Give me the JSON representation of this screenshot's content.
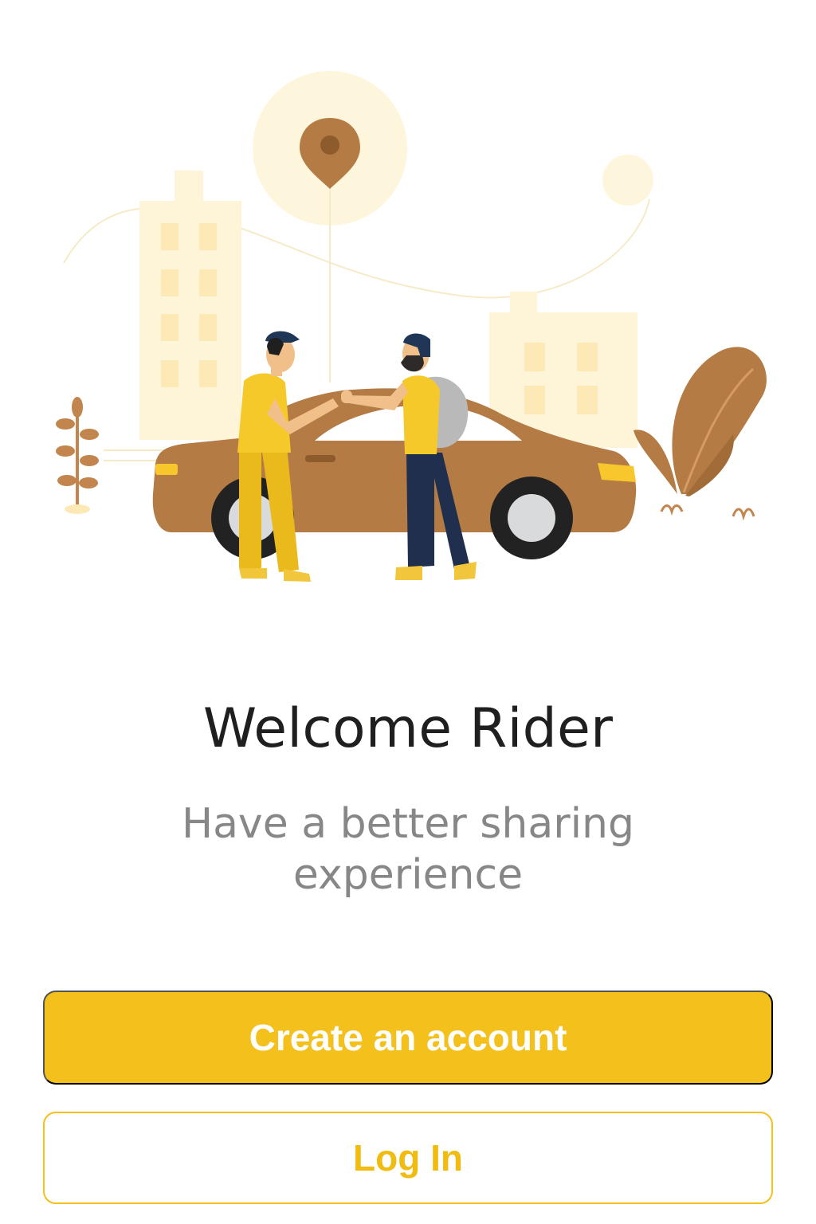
{
  "hero": {
    "illustration": "rider-greeting-driver-illustration",
    "icons": [
      "location-pin-icon",
      "car-icon"
    ]
  },
  "welcome": {
    "title": "Welcome Rider",
    "subtitle": "Have a better sharing experience"
  },
  "actions": {
    "create_account_label": "Create an account",
    "login_label": "Log In"
  },
  "colors": {
    "accent": "#f3c01c",
    "car": "#b47b45",
    "background": "#ffffff",
    "title_text": "#1f1f1f",
    "subtitle_text": "#878787"
  }
}
